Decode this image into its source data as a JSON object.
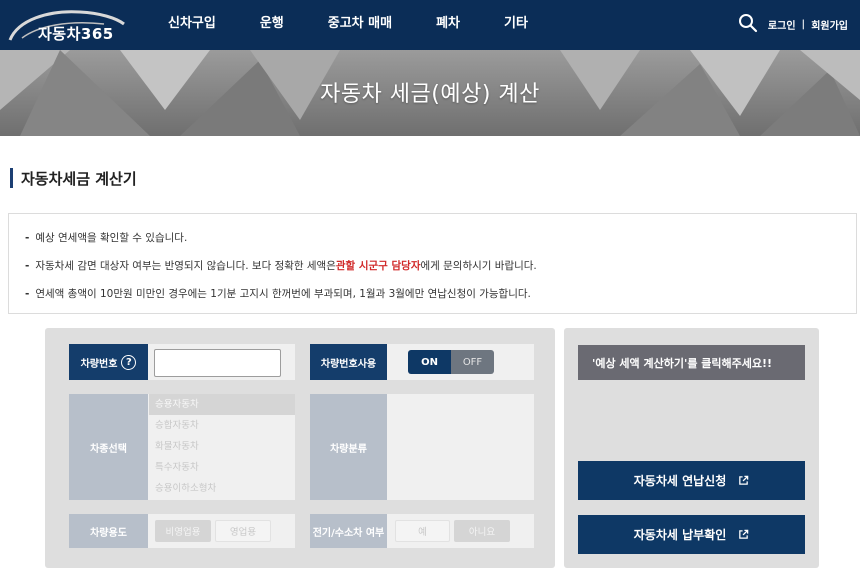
{
  "header": {
    "logo_text": "자동차365",
    "nav": [
      "신차구입",
      "운행",
      "중고차 매매",
      "폐차",
      "기타"
    ],
    "login": "로그인",
    "separator": "|",
    "signup": "회원가입"
  },
  "banner": {
    "title": "자동차 세금(예상) 계산"
  },
  "section": {
    "title": "자동차세금 계산기"
  },
  "notice": {
    "dash": "-",
    "line1": "예상 연세액을 확인할 수 있습니다.",
    "line2_prefix": "자동차세 감면 대상자 여부는 반영되지 않습니다. 보다 정확한 세액은 ",
    "line2_highlight": "관할 시군구 담당자",
    "line2_suffix": "에게 문의하시기 바랍니다.",
    "line3": "연세액 총액이 10만원 미만인 경우에는 1기분 고지시 한꺼번에 부과되며, 1월과 3월에만 연납신청이 가능합니다."
  },
  "calculator": {
    "plate_label": "차량번호",
    "help_glyph": "?",
    "plate_value": "",
    "plate_use_label": "차량번호사용",
    "toggle_on": "ON",
    "toggle_off": "OFF",
    "type_label": "차종선택",
    "types": [
      "승용자동차",
      "승합자동차",
      "화물자동차",
      "특수자동차",
      "승용이하소형차"
    ],
    "category_label": "차량분류",
    "use_label": "차량용도",
    "use_opt1": "비영업용",
    "use_opt2": "영업용",
    "ev_label": "전기/수소차 여부",
    "ev_yes": "예",
    "ev_no": "아니요"
  },
  "result": {
    "hint": "'예상 세액 계산하기'를 클릭해주세요!!",
    "annual_button": "자동차세 연납신청",
    "payment_button": "자동차세 납부확인"
  },
  "colors": {
    "navy": "#0b2d57",
    "accent_red": "#d12a2a",
    "panel_gray": "#dedede"
  },
  "icons": {
    "search": "search-icon",
    "external": "external-link-icon",
    "help": "help-icon"
  }
}
